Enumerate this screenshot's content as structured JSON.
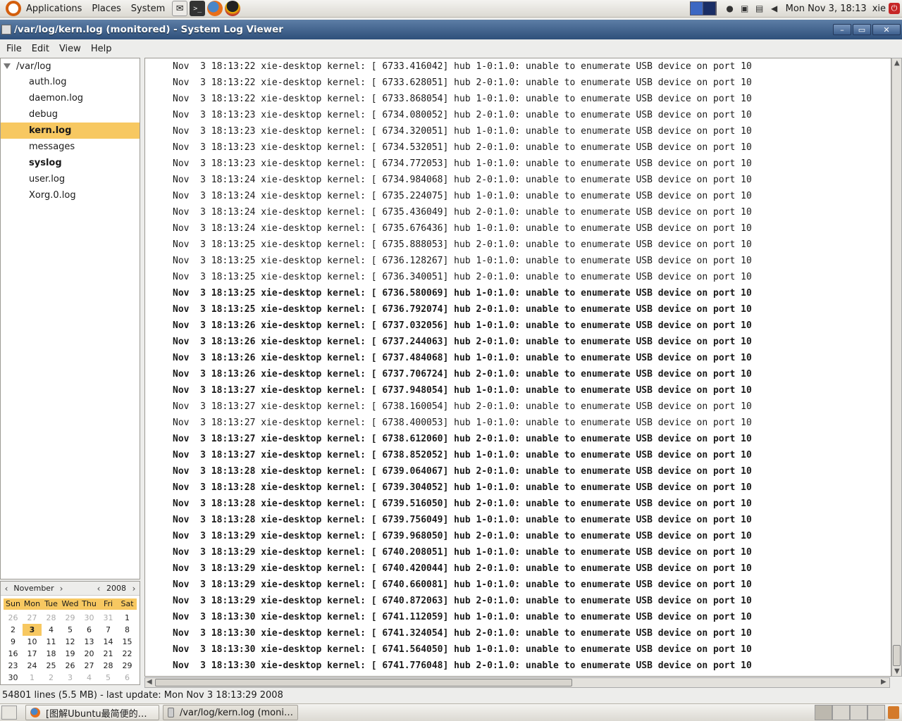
{
  "top_panel": {
    "menus": [
      "Applications",
      "Places",
      "System"
    ],
    "clock": "Mon Nov  3, 18:13",
    "user": "xie"
  },
  "window": {
    "title": "/var/log/kern.log (monitored) - System Log Viewer",
    "menus": [
      "File",
      "Edit",
      "View",
      "Help"
    ]
  },
  "sidebar": {
    "root": "/var/log",
    "items": [
      {
        "label": "auth.log",
        "state": "normal"
      },
      {
        "label": "daemon.log",
        "state": "normal"
      },
      {
        "label": "debug",
        "state": "normal"
      },
      {
        "label": "kern.log",
        "state": "selected"
      },
      {
        "label": "messages",
        "state": "normal"
      },
      {
        "label": "syslog",
        "state": "bold"
      },
      {
        "label": "user.log",
        "state": "normal"
      },
      {
        "label": "Xorg.0.log",
        "state": "normal"
      }
    ]
  },
  "calendar": {
    "month": "November",
    "year": "2008",
    "day_names": [
      "Sun",
      "Mon",
      "Tue",
      "Wed",
      "Thu",
      "Fri",
      "Sat"
    ],
    "days": [
      "26",
      "27",
      "28",
      "29",
      "30",
      "31",
      "1",
      "2",
      "3",
      "4",
      "5",
      "6",
      "7",
      "8",
      "9",
      "10",
      "11",
      "12",
      "13",
      "14",
      "15",
      "16",
      "17",
      "18",
      "19",
      "20",
      "21",
      "22",
      "23",
      "24",
      "25",
      "26",
      "27",
      "28",
      "29",
      "30",
      "1",
      "2",
      "3",
      "4",
      "5",
      "6"
    ],
    "today": "3"
  },
  "log": {
    "lines": [
      {
        "text": "Nov  3 18:13:22 xie-desktop kernel: [ 6733.416042] hub 1-0:1.0: unable to enumerate USB device on port 10",
        "bold": false
      },
      {
        "text": "Nov  3 18:13:22 xie-desktop kernel: [ 6733.628051] hub 2-0:1.0: unable to enumerate USB device on port 10",
        "bold": false
      },
      {
        "text": "Nov  3 18:13:22 xie-desktop kernel: [ 6733.868054] hub 1-0:1.0: unable to enumerate USB device on port 10",
        "bold": false
      },
      {
        "text": "Nov  3 18:13:23 xie-desktop kernel: [ 6734.080052] hub 2-0:1.0: unable to enumerate USB device on port 10",
        "bold": false
      },
      {
        "text": "Nov  3 18:13:23 xie-desktop kernel: [ 6734.320051] hub 1-0:1.0: unable to enumerate USB device on port 10",
        "bold": false
      },
      {
        "text": "Nov  3 18:13:23 xie-desktop kernel: [ 6734.532051] hub 2-0:1.0: unable to enumerate USB device on port 10",
        "bold": false
      },
      {
        "text": "Nov  3 18:13:23 xie-desktop kernel: [ 6734.772053] hub 1-0:1.0: unable to enumerate USB device on port 10",
        "bold": false
      },
      {
        "text": "Nov  3 18:13:24 xie-desktop kernel: [ 6734.984068] hub 2-0:1.0: unable to enumerate USB device on port 10",
        "bold": false
      },
      {
        "text": "Nov  3 18:13:24 xie-desktop kernel: [ 6735.224075] hub 1-0:1.0: unable to enumerate USB device on port 10",
        "bold": false
      },
      {
        "text": "Nov  3 18:13:24 xie-desktop kernel: [ 6735.436049] hub 2-0:1.0: unable to enumerate USB device on port 10",
        "bold": false
      },
      {
        "text": "Nov  3 18:13:24 xie-desktop kernel: [ 6735.676436] hub 1-0:1.0: unable to enumerate USB device on port 10",
        "bold": false
      },
      {
        "text": "Nov  3 18:13:25 xie-desktop kernel: [ 6735.888053] hub 2-0:1.0: unable to enumerate USB device on port 10",
        "bold": false
      },
      {
        "text": "Nov  3 18:13:25 xie-desktop kernel: [ 6736.128267] hub 1-0:1.0: unable to enumerate USB device on port 10",
        "bold": false
      },
      {
        "text": "Nov  3 18:13:25 xie-desktop kernel: [ 6736.340051] hub 2-0:1.0: unable to enumerate USB device on port 10",
        "bold": false
      },
      {
        "text": "Nov  3 18:13:25 xie-desktop kernel: [ 6736.580069] hub 1-0:1.0: unable to enumerate USB device on port 10",
        "bold": true
      },
      {
        "text": "Nov  3 18:13:25 xie-desktop kernel: [ 6736.792074] hub 2-0:1.0: unable to enumerate USB device on port 10",
        "bold": true
      },
      {
        "text": "Nov  3 18:13:26 xie-desktop kernel: [ 6737.032056] hub 1-0:1.0: unable to enumerate USB device on port 10",
        "bold": true
      },
      {
        "text": "Nov  3 18:13:26 xie-desktop kernel: [ 6737.244063] hub 2-0:1.0: unable to enumerate USB device on port 10",
        "bold": true
      },
      {
        "text": "Nov  3 18:13:26 xie-desktop kernel: [ 6737.484068] hub 1-0:1.0: unable to enumerate USB device on port 10",
        "bold": true
      },
      {
        "text": "Nov  3 18:13:26 xie-desktop kernel: [ 6737.706724] hub 2-0:1.0: unable to enumerate USB device on port 10",
        "bold": true
      },
      {
        "text": "Nov  3 18:13:27 xie-desktop kernel: [ 6737.948054] hub 1-0:1.0: unable to enumerate USB device on port 10",
        "bold": true
      },
      {
        "text": "Nov  3 18:13:27 xie-desktop kernel: [ 6738.160054] hub 2-0:1.0: unable to enumerate USB device on port 10",
        "bold": false
      },
      {
        "text": "Nov  3 18:13:27 xie-desktop kernel: [ 6738.400053] hub 1-0:1.0: unable to enumerate USB device on port 10",
        "bold": false
      },
      {
        "text": "Nov  3 18:13:27 xie-desktop kernel: [ 6738.612060] hub 2-0:1.0: unable to enumerate USB device on port 10",
        "bold": true
      },
      {
        "text": "Nov  3 18:13:27 xie-desktop kernel: [ 6738.852052] hub 1-0:1.0: unable to enumerate USB device on port 10",
        "bold": true
      },
      {
        "text": "Nov  3 18:13:28 xie-desktop kernel: [ 6739.064067] hub 2-0:1.0: unable to enumerate USB device on port 10",
        "bold": true
      },
      {
        "text": "Nov  3 18:13:28 xie-desktop kernel: [ 6739.304052] hub 1-0:1.0: unable to enumerate USB device on port 10",
        "bold": true
      },
      {
        "text": "Nov  3 18:13:28 xie-desktop kernel: [ 6739.516050] hub 2-0:1.0: unable to enumerate USB device on port 10",
        "bold": true
      },
      {
        "text": "Nov  3 18:13:28 xie-desktop kernel: [ 6739.756049] hub 1-0:1.0: unable to enumerate USB device on port 10",
        "bold": true
      },
      {
        "text": "Nov  3 18:13:29 xie-desktop kernel: [ 6739.968050] hub 2-0:1.0: unable to enumerate USB device on port 10",
        "bold": true
      },
      {
        "text": "Nov  3 18:13:29 xie-desktop kernel: [ 6740.208051] hub 1-0:1.0: unable to enumerate USB device on port 10",
        "bold": true
      },
      {
        "text": "Nov  3 18:13:29 xie-desktop kernel: [ 6740.420044] hub 2-0:1.0: unable to enumerate USB device on port 10",
        "bold": true
      },
      {
        "text": "Nov  3 18:13:29 xie-desktop kernel: [ 6740.660081] hub 1-0:1.0: unable to enumerate USB device on port 10",
        "bold": true
      },
      {
        "text": "Nov  3 18:13:29 xie-desktop kernel: [ 6740.872063] hub 2-0:1.0: unable to enumerate USB device on port 10",
        "bold": true
      },
      {
        "text": "Nov  3 18:13:30 xie-desktop kernel: [ 6741.112059] hub 1-0:1.0: unable to enumerate USB device on port 10",
        "bold": true
      },
      {
        "text": "Nov  3 18:13:30 xie-desktop kernel: [ 6741.324054] hub 2-0:1.0: unable to enumerate USB device on port 10",
        "bold": true
      },
      {
        "text": "Nov  3 18:13:30 xie-desktop kernel: [ 6741.564050] hub 1-0:1.0: unable to enumerate USB device on port 10",
        "bold": true
      },
      {
        "text": "Nov  3 18:13:30 xie-desktop kernel: [ 6741.776048] hub 2-0:1.0: unable to enumerate USB device on port 10",
        "bold": true
      }
    ]
  },
  "status": "54801 lines (5.5 MB) - last update: Mon Nov  3 18:13:29 2008",
  "taskbar": {
    "tasks": [
      "[图解Ubuntu最简便的…",
      "/var/log/kern.log (moni…"
    ]
  },
  "colors": {
    "selection": "#f7c861",
    "titlebar": "#3e5f8c"
  }
}
